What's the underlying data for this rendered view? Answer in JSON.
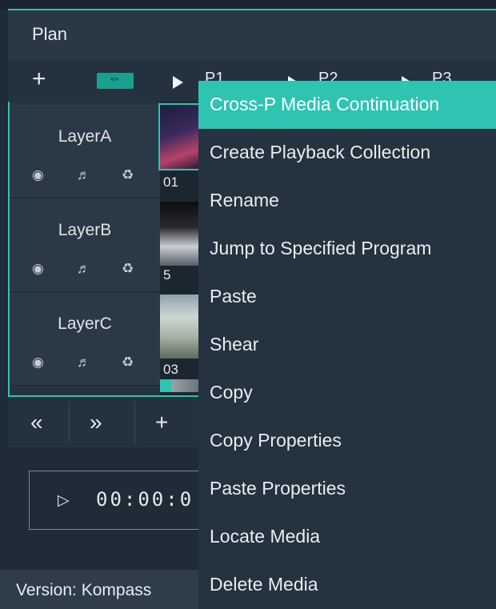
{
  "window": {
    "title": "Plan"
  },
  "toolbar": {
    "add_icon": "+",
    "link_icon": "link-icon",
    "programs": [
      "P1",
      "P2",
      "P3"
    ]
  },
  "layers": [
    {
      "name": "LayerA",
      "thumb_number": "01"
    },
    {
      "name": "LayerB",
      "thumb_number": "5"
    },
    {
      "name": "LayerC",
      "thumb_number": "03"
    }
  ],
  "layer_icons": [
    "eye-icon",
    "speaker-icon",
    "lock-icon"
  ],
  "controls": {
    "prev": "«",
    "next": "»",
    "add": "+"
  },
  "timecode": {
    "play": "▷",
    "value": "00:00:0"
  },
  "footer": {
    "version": "Version: Kompass"
  },
  "context_menu": {
    "items": [
      "Cross-P Media Continuation",
      "Create Playback Collection",
      "Rename",
      "Jump to Specified Program",
      "Paste",
      "Shear",
      "Copy",
      "Copy Properties",
      "Paste Properties",
      "Locate Media",
      "Delete Media"
    ],
    "active_index": 0
  },
  "colors": {
    "accent": "#2fc4b2",
    "background": "#1f2c38",
    "menu_bg": "#25323f"
  }
}
